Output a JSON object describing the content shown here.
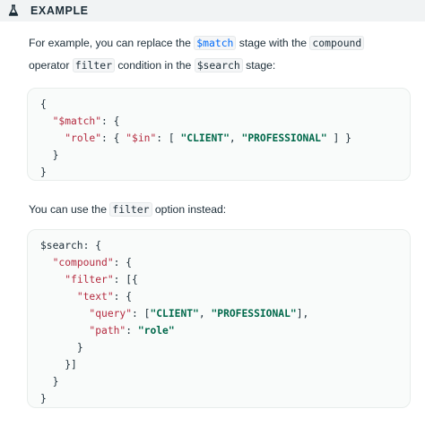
{
  "callout": {
    "title": "EXAMPLE",
    "icon": "flask-icon"
  },
  "para1": {
    "t1": "For example, you can replace the ",
    "c1": "$match",
    "t2": " stage with the ",
    "c2": "compound",
    "t3": " operator ",
    "c3": "filter",
    "t4": " condition in the ",
    "c4": "$search",
    "t5": " stage:"
  },
  "code1": {
    "l1": "{",
    "l2_key": "\"$match\"",
    "l2_rest": ": {",
    "l3_key": "\"role\"",
    "l3_mid1": ": { ",
    "l3_key2": "\"$in\"",
    "l3_mid2": ": [ ",
    "l3_v1": "\"CLIENT\"",
    "l3_sep": ", ",
    "l3_v2": "\"PROFESSIONAL\"",
    "l3_end": " ] }",
    "l4": "}",
    "l5": "}"
  },
  "para2": {
    "t1": "You can use the ",
    "c1": "filter",
    "t2": " option instead:"
  },
  "code2": {
    "l1": "$search: {",
    "l2_key": "\"compound\"",
    "l2_rest": ": {",
    "l3_key": "\"filter\"",
    "l3_rest": ": [{",
    "l4_key": "\"text\"",
    "l4_rest": ": {",
    "l5_key": "\"query\"",
    "l5_mid": ": [",
    "l5_v1": "\"CLIENT\"",
    "l5_sep": ", ",
    "l5_v2": "\"PROFESSIONAL\"",
    "l5_end": "],",
    "l6_key": "\"path\"",
    "l6_mid": ": ",
    "l6_v": "\"role\"",
    "l7": "}",
    "l8": "}]",
    "l9": "}",
    "l10": "}"
  }
}
